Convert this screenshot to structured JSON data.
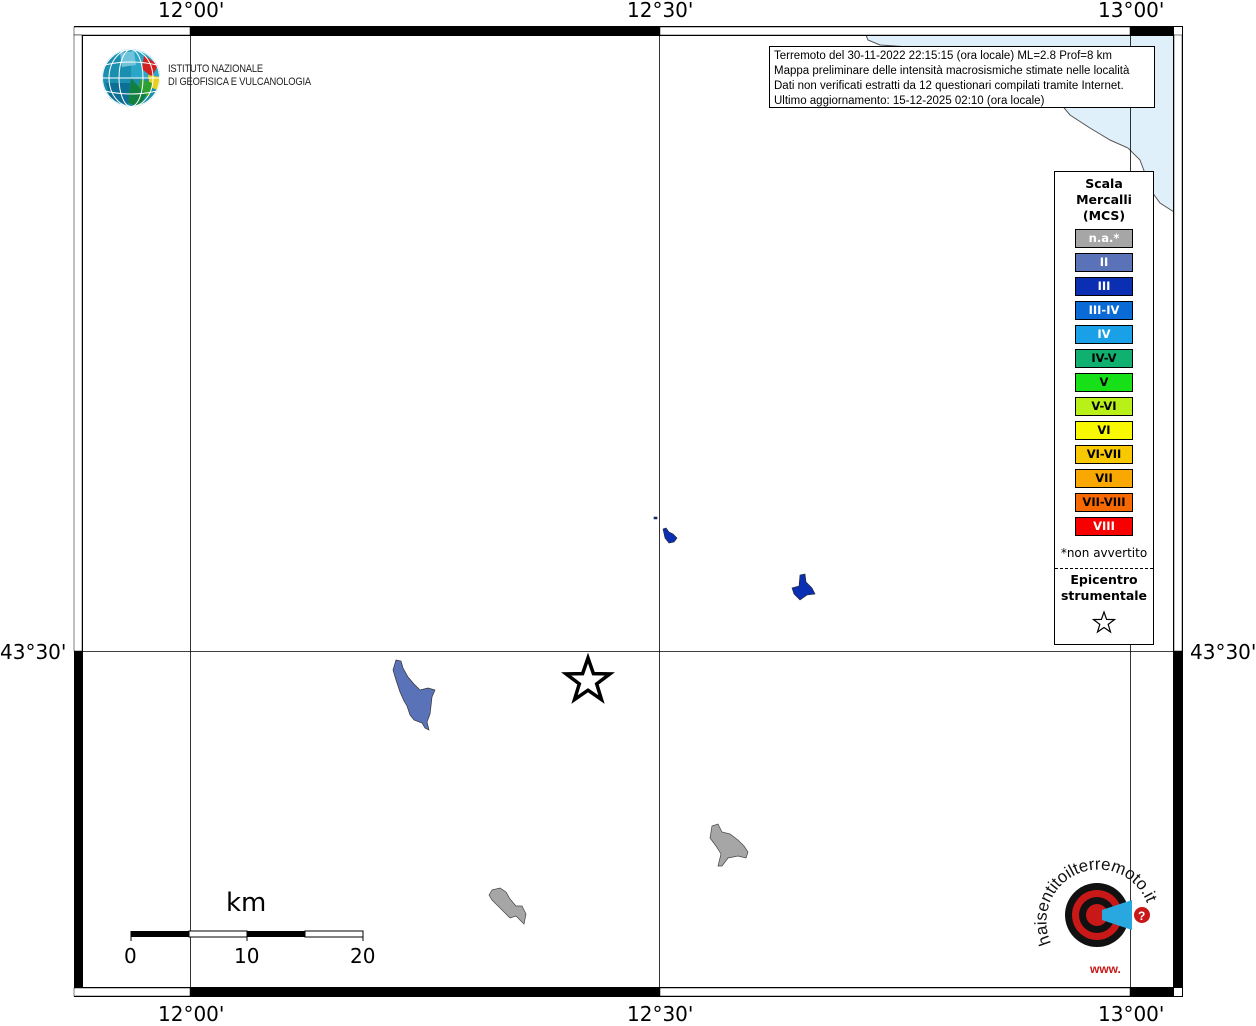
{
  "map": {
    "lon_labels": [
      "12°00'",
      "12°30'",
      "13°00'"
    ],
    "lat_labels": [
      "43°30'"
    ],
    "colors": {
      "sea": "#dff0fa",
      "intensity_II": "#5a73b8",
      "intensity_III": "#0a2fb3",
      "not_felt": "#a6a6a6",
      "frame": "#000000"
    }
  },
  "logo": {
    "name": "ingv-logo",
    "line1": "ISTITUTO NAZIONALE",
    "line2": "DI GEOFISICA E VULCANOLOGIA"
  },
  "info": {
    "line1": "Terremoto del 30-11-2022 22:15:15 (ora locale) ML=2.8 Prof=8 km",
    "line2": "Mappa preliminare delle intensità macrosismiche stimate nelle località",
    "line3": "Dati non verificati estratti da 12 questionari compilati tramite Internet.",
    "line4": "Ultimo aggiornamento: 15-12-2025 02:10 (ora locale)"
  },
  "legend": {
    "title1": "Scala",
    "title2": "Mercalli",
    "title3": "(MCS)",
    "items": [
      {
        "label": "n.a.*",
        "color": "#a6a6a6"
      },
      {
        "label": "II",
        "color": "#5a73b8"
      },
      {
        "label": "III",
        "color": "#0a2fb3"
      },
      {
        "label": "III-IV",
        "color": "#0a6bd6"
      },
      {
        "label": "IV",
        "color": "#1aa0e6"
      },
      {
        "label": "IV-V",
        "color": "#10b070"
      },
      {
        "label": "V",
        "color": "#18e018"
      },
      {
        "label": "V-VI",
        "color": "#b8f018"
      },
      {
        "label": "VI",
        "color": "#f8f800"
      },
      {
        "label": "VI-VII",
        "color": "#f8c800"
      },
      {
        "label": "VII",
        "color": "#f8a800"
      },
      {
        "label": "VII-VIII",
        "color": "#f86800"
      },
      {
        "label": "VIII",
        "color": "#f80000"
      }
    ],
    "note": "*non avvertito",
    "epi1": "Epicentro",
    "epi2": "strumentale"
  },
  "scale": {
    "unit": "km",
    "ticks": [
      "0",
      "10",
      "20"
    ]
  },
  "hsl_logo": {
    "text": "haisentitoilterremoto.it",
    "prefix": "www."
  }
}
